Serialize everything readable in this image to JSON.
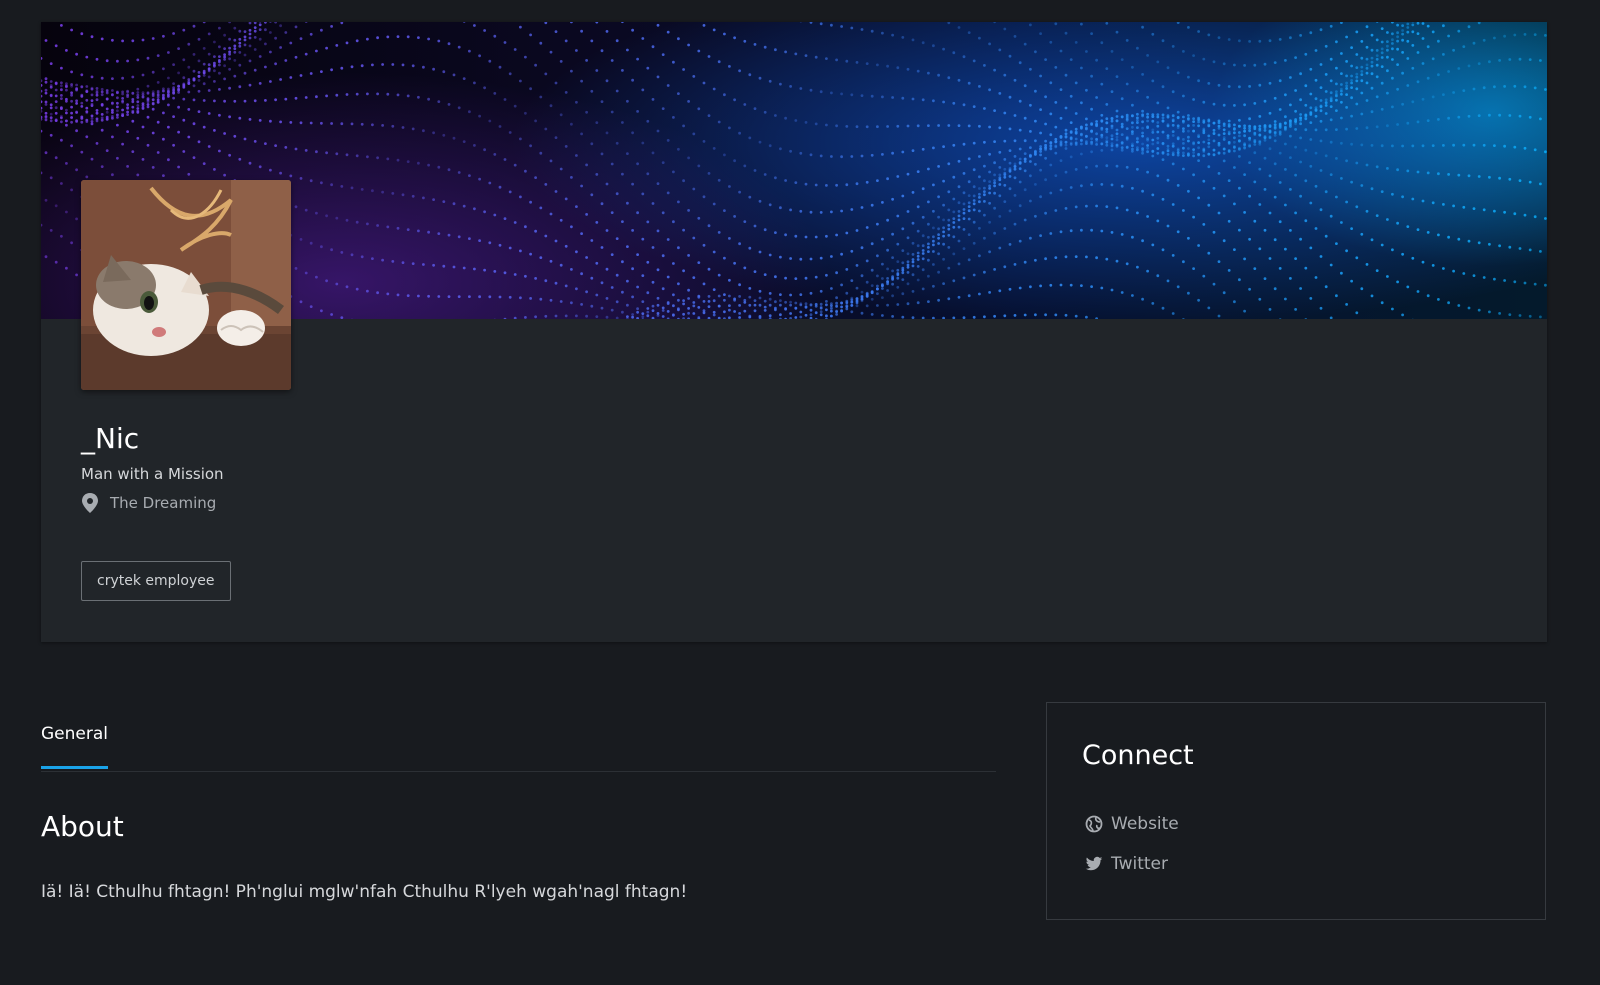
{
  "profile": {
    "username": "_Nic",
    "tagline": "Man with a Mission",
    "location": "The Dreaming",
    "badge": "crytek employee",
    "avatar_icon": "cat-photo",
    "banner_icon": "blue-particle-wave"
  },
  "tabs": [
    {
      "label": "General",
      "active": true
    }
  ],
  "about": {
    "title": "About",
    "text": "Iä! Iä! Cthulhu fhtagn! Ph'nglui mglw'nfah Cthulhu R'lyeh wgah'nagl fhtagn!"
  },
  "connect": {
    "title": "Connect",
    "links": [
      {
        "label": "Website",
        "icon": "globe-icon"
      },
      {
        "label": "Twitter",
        "icon": "twitter-icon"
      }
    ]
  },
  "colors": {
    "background": "#181b1f",
    "card": "#212529",
    "accent": "#1aa3e8",
    "muted_text": "#a8acb1"
  }
}
